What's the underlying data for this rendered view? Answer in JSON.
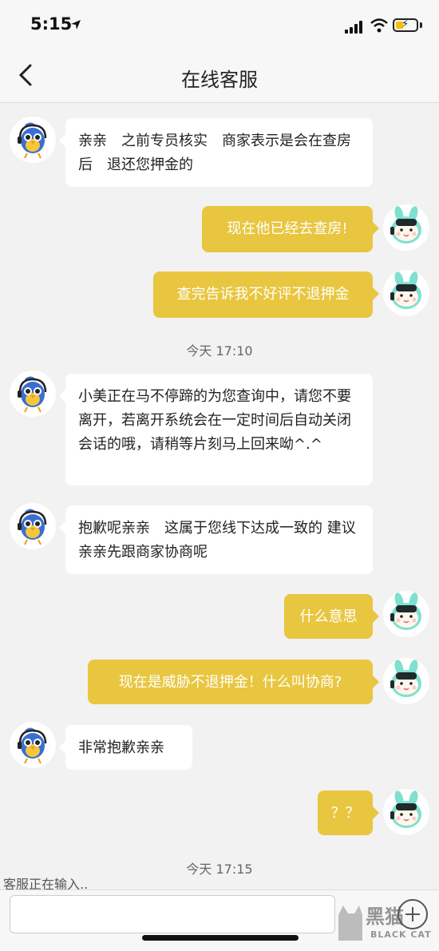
{
  "status": {
    "time": "5:15"
  },
  "header": {
    "title": "在线客服"
  },
  "messages": [
    {
      "text": "亲亲　之前专员核实　商家表示是会在查房后　退还您押金的"
    },
    {
      "text": "现在他已经去查房!"
    },
    {
      "text": "查完告诉我不好评不退押金"
    },
    {
      "text": "小美正在马不停蹄的为您查询中，请您不要离开，若离开系统会在一定时间后自动关闭会话的哦，请稍等片刻马上回来呦^.^"
    },
    {
      "text": "抱歉呢亲亲　这属于您线下达成一致的 建议亲亲先跟商家协商呢"
    },
    {
      "text": "什么意思"
    },
    {
      "text": "现在是威胁不退押金！什么叫协商?"
    },
    {
      "text": "非常抱歉亲亲"
    },
    {
      "text": "？？"
    }
  ],
  "timestamps": [
    "今天 17:10",
    "今天 17:15"
  ],
  "typing_status": "客服正在输入..",
  "watermark": {
    "text": "黑猫",
    "sub": "BLACK CAT"
  },
  "icons": {
    "agent_avatar": "blue-bird-headset-icon",
    "user_avatar": "mint-bunny-headset-icon",
    "back": "chevron-left-icon",
    "add": "plus-circle-icon"
  },
  "colors": {
    "user_bubble": "#e8c63f",
    "agent_bubble": "#ffffff",
    "background": "#f2f2f2"
  }
}
